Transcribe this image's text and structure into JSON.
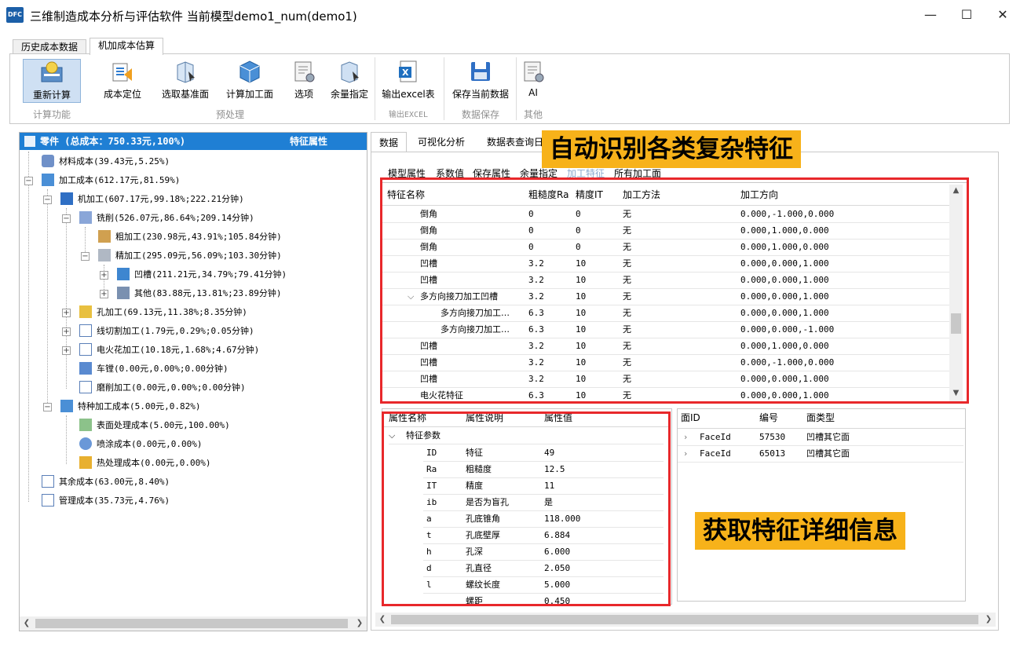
{
  "window": {
    "logo": "DFC",
    "title": "三维制造成本分析与评估软件  当前模型demo1_num(demo1)",
    "minimize": "—",
    "maximize": "☐",
    "close": "✕"
  },
  "ribbon": {
    "tabs": [
      "历史成本数据",
      "机加成本估算"
    ],
    "buttons": {
      "recalc": "重新计算",
      "cost_locate": "成本定位",
      "select_base": "选取基准面",
      "calc_face": "计算加工面",
      "options": "选项",
      "allowance": "余量指定",
      "export_excel": "输出excel表",
      "save_data": "保存当前数据",
      "ai": "AI"
    },
    "groups": {
      "calc": "计算功能",
      "preprocess": "预处理",
      "export": "输出EXCEL",
      "save": "数据保存",
      "other": "其他"
    }
  },
  "tree": {
    "header_left": "零件 (总成本：750.33元,100%)",
    "header_right": "特征属性",
    "rows": [
      "材料成本(39.43元,5.25%)",
      "加工成本(612.17元,81.59%)",
      "机加工(607.17元,99.18%;222.21分钟)",
      "铣削(526.07元,86.64%;209.14分钟)",
      "粗加工(230.98元,43.91%;105.84分钟)",
      "精加工(295.09元,56.09%;103.30分钟)",
      "凹槽(211.21元,34.79%;79.41分钟)",
      "其他(83.88元,13.81%;23.89分钟)",
      "孔加工(69.13元,11.38%;8.35分钟)",
      "线切割加工(1.79元,0.29%;0.05分钟)",
      "电火花加工(10.18元,1.68%;4.67分钟)",
      "车镗(0.00元,0.00%;0.00分钟)",
      "磨削加工(0.00元,0.00%;0.00分钟)",
      "特种加工成本(5.00元,0.82%)",
      "表面处理成本(5.00元,100.00%)",
      "喷涂成本(0.00元,0.00%)",
      "热处理成本(0.00元,0.00%)",
      "其余成本(63.00元,8.40%)",
      "管理成本(35.73元,4.76%)"
    ]
  },
  "right_tabs": [
    "数据",
    "可视化分析",
    "数据表查询日"
  ],
  "sub_tabs": [
    "模型属性",
    "系数值",
    "保存属性",
    "余量指定",
    "加工特征",
    "所有加工面"
  ],
  "feature_table": {
    "headers": [
      "特征名称",
      "粗糙度Ra",
      "精度IT",
      "加工方法",
      "加工方向"
    ],
    "rows": [
      {
        "name": "倒角",
        "ra": "0",
        "it": "0",
        "method": "无",
        "dir": "0.000,-1.000,0.000"
      },
      {
        "name": "倒角",
        "ra": "0",
        "it": "0",
        "method": "无",
        "dir": "0.000,1.000,0.000"
      },
      {
        "name": "倒角",
        "ra": "0",
        "it": "0",
        "method": "无",
        "dir": "0.000,1.000,0.000"
      },
      {
        "name": "凹槽",
        "ra": "3.2",
        "it": "10",
        "method": "无",
        "dir": "0.000,0.000,1.000"
      },
      {
        "name": "凹槽",
        "ra": "3.2",
        "it": "10",
        "method": "无",
        "dir": "0.000,0.000,1.000"
      },
      {
        "name": "多方向接刀加工凹槽",
        "ra": "3.2",
        "it": "10",
        "method": "无",
        "dir": "0.000,0.000,1.000"
      },
      {
        "name": "多方向接刀加工…",
        "ra": "6.3",
        "it": "10",
        "method": "无",
        "dir": "0.000,0.000,1.000"
      },
      {
        "name": "多方向接刀加工…",
        "ra": "6.3",
        "it": "10",
        "method": "无",
        "dir": "0.000,0.000,-1.000"
      },
      {
        "name": "凹槽",
        "ra": "3.2",
        "it": "10",
        "method": "无",
        "dir": "0.000,1.000,0.000"
      },
      {
        "name": "凹槽",
        "ra": "3.2",
        "it": "10",
        "method": "无",
        "dir": "0.000,-1.000,0.000"
      },
      {
        "name": "凹槽",
        "ra": "3.2",
        "it": "10",
        "method": "无",
        "dir": "0.000,0.000,1.000"
      },
      {
        "name": "电火花特征",
        "ra": "6.3",
        "it": "10",
        "method": "无",
        "dir": "0.000,0.000,1.000"
      }
    ]
  },
  "attr_table": {
    "headers": [
      "属性名称",
      "属性说明",
      "属性值"
    ],
    "group": "特征参数",
    "rows": [
      {
        "name": "ID",
        "desc": "特征",
        "val": "49"
      },
      {
        "name": "Ra",
        "desc": "粗糙度",
        "val": "12.5"
      },
      {
        "name": "IT",
        "desc": "精度",
        "val": "11"
      },
      {
        "name": "ib",
        "desc": "是否为盲孔",
        "val": "是"
      },
      {
        "name": "a",
        "desc": "孔底锥角",
        "val": "118.000"
      },
      {
        "name": "t",
        "desc": "孔底壁厚",
        "val": "6.884"
      },
      {
        "name": "h",
        "desc": "孔深",
        "val": "6.000"
      },
      {
        "name": "d",
        "desc": "孔直径",
        "val": "2.050"
      },
      {
        "name": "l",
        "desc": "螺纹长度",
        "val": "5.000"
      },
      {
        "name": "",
        "desc": "螺距",
        "val": "0.450"
      }
    ]
  },
  "face_table": {
    "headers": [
      "面ID",
      "编号",
      "面类型"
    ],
    "rows": [
      {
        "id": "FaceId",
        "num": "57530",
        "type": "凹槽其它面"
      },
      {
        "id": "FaceId",
        "num": "65013",
        "type": "凹槽其它面"
      }
    ]
  },
  "callouts": {
    "top": "自动识别各类复杂特征",
    "bottom": "获取特征详细信息"
  },
  "colors": {
    "accent": "#1f7fd4",
    "callout": "#f7b21a",
    "highlight_box": "#e8282b"
  }
}
